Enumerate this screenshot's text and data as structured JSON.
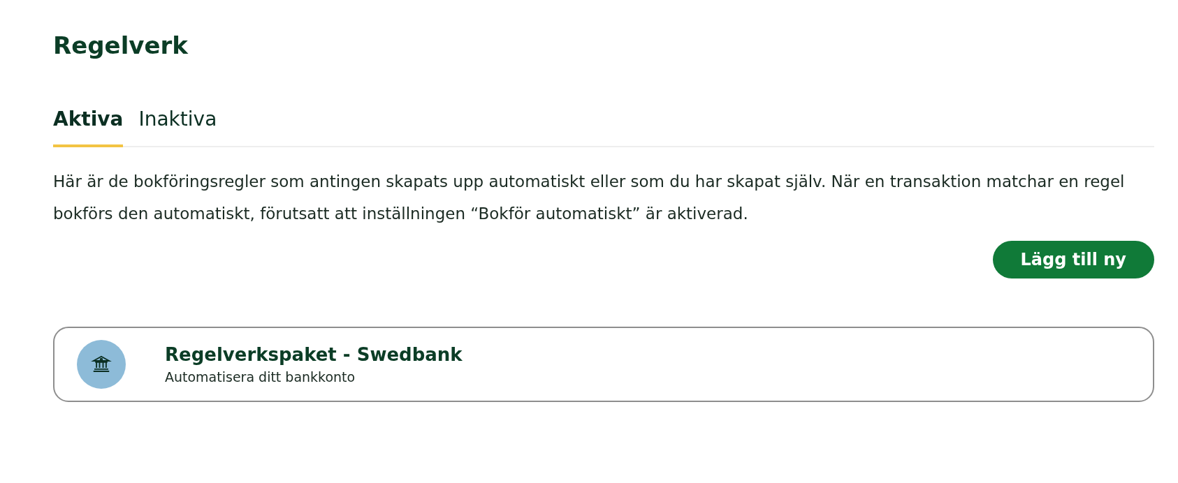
{
  "title": "Regelverk",
  "tabs": [
    {
      "label": "Aktiva",
      "selected": true
    },
    {
      "label": "Inaktiva",
      "selected": false
    }
  ],
  "description": "Här är de bokföringsregler som antingen skapats upp automatiskt eller som du har skapat själv. När en transaktion matchar en regel bokförs den automatiskt, förutsatt att inställningen “Bokför automatiskt” är aktiverad.",
  "add_button": "Lägg till ny",
  "rule_packages": [
    {
      "title": "Regelverkspaket - Swedbank",
      "subtitle": "Automatisera ditt bankkonto"
    }
  ]
}
